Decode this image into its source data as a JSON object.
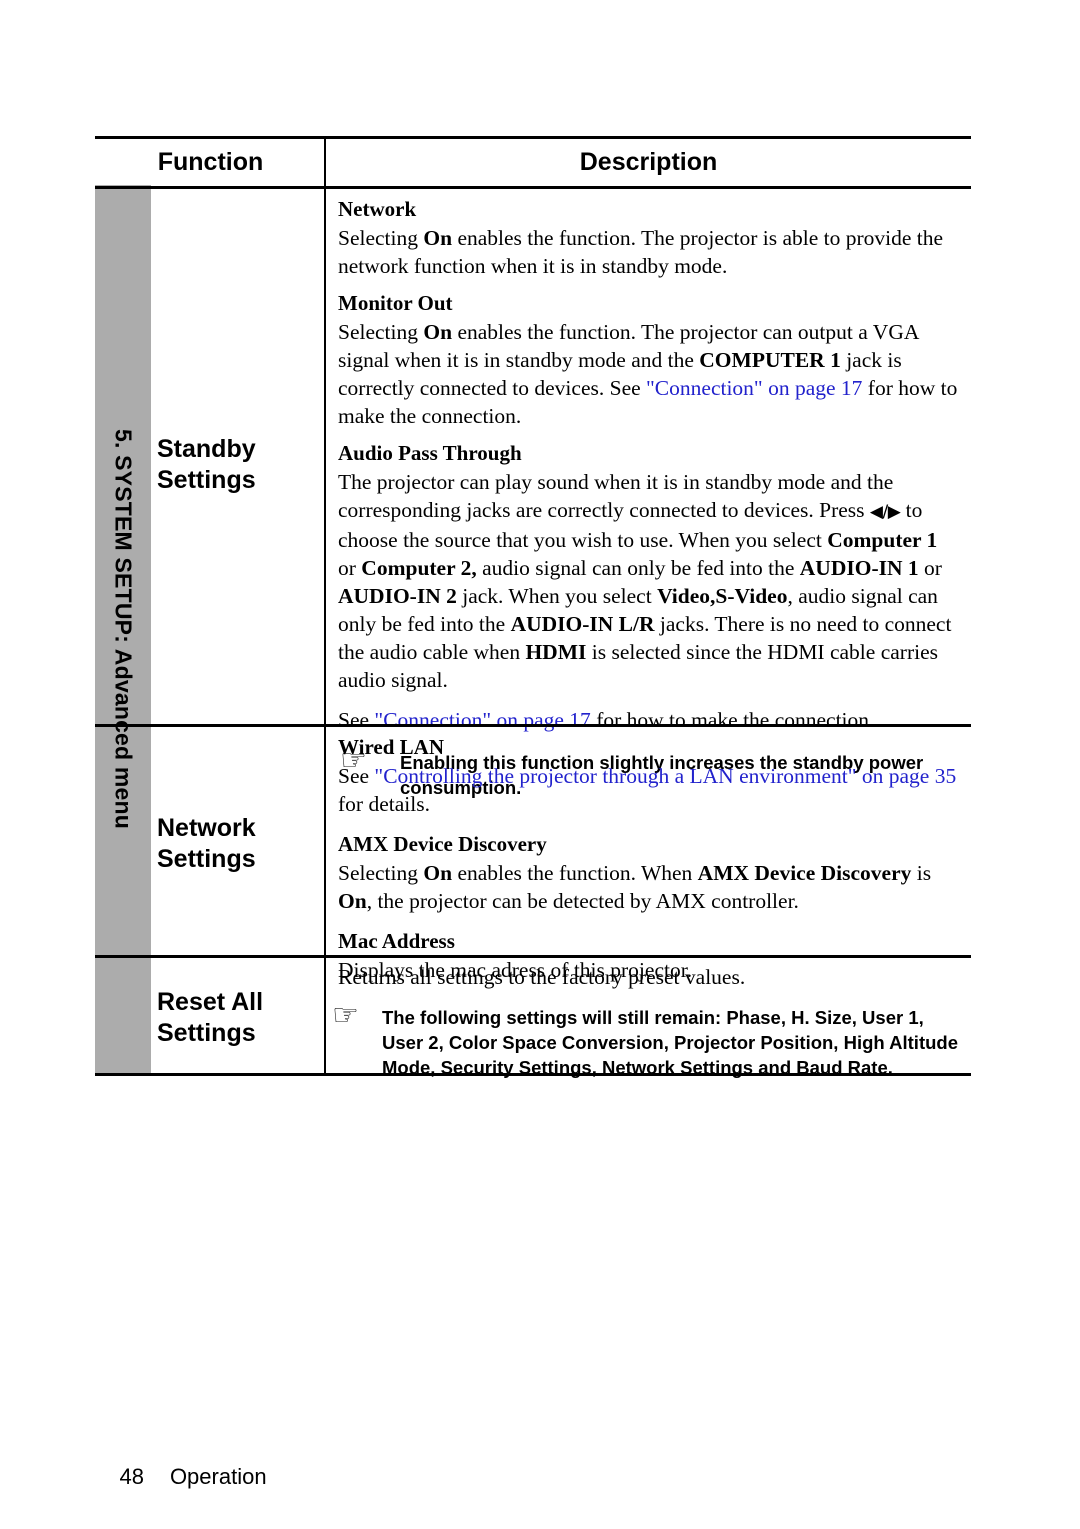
{
  "side_tab": {
    "label": "5. SYSTEM SETUP: Advanced menu"
  },
  "table": {
    "headers": {
      "function": "Function",
      "description": "Description"
    },
    "rows": [
      {
        "function": "Standby\nSettings",
        "function_line1": "Standby",
        "function_line2": "Settings",
        "blocks": [
          {
            "kind": "subhead",
            "text": "Network"
          },
          {
            "kind": "para",
            "text": "Selecting On enables the function. The projector is able to provide the network function when it is in standby mode."
          },
          {
            "kind": "subhead",
            "text": "Monitor Out"
          },
          {
            "kind": "para",
            "text": "Selecting On enables the function. The projector can output a VGA signal when it is in standby mode and the COMPUTER 1 jack is correctly connected to devices. See \"Connection\" on page 17 for how to make the connection."
          },
          {
            "kind": "subhead",
            "text": "Audio Pass Through"
          },
          {
            "kind": "para",
            "text": "The projector can play sound when it is in standby mode and the corresponding jacks are correctly connected to devices. Press ◀/▶ to choose the source that you wish to use. When you select Computer 1 or Computer 2, audio signal can only be fed into the AUDIO-IN 1 or AUDIO-IN 2 jack. When you select Video,S-Video, audio signal can only be fed into the AUDIO-IN L/R jacks. There is no need to connect the audio cable when HDMI is selected since the HDMI cable carries audio signal."
          },
          {
            "kind": "para",
            "text": "See \"Connection\" on page 17 for how to make the connection."
          },
          {
            "kind": "note",
            "icon": "pointing-hand-icon",
            "text": "Enabling this function slightly increases the standby power consumption."
          }
        ]
      },
      {
        "function": "Network\nSettings",
        "function_line1": "Network",
        "function_line2": "Settings",
        "blocks": [
          {
            "kind": "subhead",
            "text": "Wired LAN"
          },
          {
            "kind": "para",
            "text": "See \"Controlling the projector through a LAN environment\" on page 35 for details."
          },
          {
            "kind": "subhead",
            "text": "AMX Device Discovery"
          },
          {
            "kind": "para",
            "text": "Selecting On enables the function. When AMX Device Discovery is On, the projector can be detected by AMX controller."
          },
          {
            "kind": "subhead",
            "text": "Mac Address"
          },
          {
            "kind": "para",
            "text": "Displays the mac adress of this projector."
          }
        ]
      },
      {
        "function": "Reset All\nSettings",
        "function_line1": "Reset All",
        "function_line2": "Settings",
        "blocks": [
          {
            "kind": "para",
            "text": "Returns all settings to the factory preset values."
          },
          {
            "kind": "note",
            "icon": "pointing-hand-icon",
            "text": "The following settings will still remain: Phase, H. Size, User 1, User 2, Color Space Conversion, Projector Position, High Altitude Mode, Security Settings, Network Settings and Baud Rate."
          }
        ]
      }
    ]
  },
  "inline_text": {
    "network_sub": "Network",
    "network_para_a": "Selecting ",
    "network_para_on": "On",
    "network_para_b": " enables the function. The projector is able to provide the network function when it is in standby mode.",
    "monitor_sub": "Monitor Out",
    "monitor_a": "Selecting ",
    "monitor_on": "On",
    "monitor_b": " enables the function. The projector can output a VGA signal when it is in standby mode and the ",
    "monitor_computer1": "COMPUTER 1",
    "monitor_c": " jack is correctly connected to devices. See ",
    "monitor_link": "\"Connection\" on page 17",
    "monitor_d": " for how to make the connection.",
    "audio_sub": "Audio Pass Through",
    "audio_a": "The projector can play sound when it is in standby mode and the corresponding jacks are correctly connected to devices. Press ",
    "audio_arrows": "◀/▶",
    "audio_b": " to choose the source that you wish to use. When you select ",
    "audio_computer1": "Computer 1",
    "audio_c": " or ",
    "audio_computer2": "Computer 2,",
    "audio_d": " audio signal can only be fed into the ",
    "audio_in1": "AUDIO-IN 1",
    "audio_e": " or ",
    "audio_in2": "AUDIO-IN 2",
    "audio_f": " jack. When you select ",
    "audio_video": "Video,S-Video",
    "audio_g": ", audio signal can only be fed into the ",
    "audio_inlr": "AUDIO-IN L/R",
    "audio_h": " jacks. There is no need to connect the audio cable when ",
    "audio_hdmi": "HDMI",
    "audio_i": " is selected since the HDMI cable carries audio signal.",
    "see_conn_a": "See ",
    "see_conn_link": "\"Connection\" on page 17",
    "see_conn_b": " for how to make the connection.",
    "standby_note": "Enabling this function slightly increases the standby power consumption.",
    "wired_sub": "Wired LAN",
    "wired_a": "See ",
    "wired_link": "\"Controlling the projector through a LAN environment\" on page 35",
    "wired_b": " for details.",
    "amx_sub": "AMX Device Discovery",
    "amx_a": "Selecting ",
    "amx_on1": "On",
    "amx_b": " enables the function. When ",
    "amx_name": "AMX Device Discovery",
    "amx_c": " is ",
    "amx_on2": "On",
    "amx_d": ", the projector can be detected by AMX controller.",
    "mac_sub": "Mac Address",
    "mac_para": "Displays the mac adress of this projector.",
    "reset_para": "Returns all settings to the factory preset values.",
    "reset_note": "The following settings will still remain: Phase, H. Size, User 1, User 2, Color Space Conversion, Projector Position, High Altitude Mode, Security Settings, Network Settings and Baud Rate."
  },
  "icons": {
    "pointing_hand": "☞"
  },
  "footer": {
    "page_number": "48",
    "section": "Operation"
  },
  "colors": {
    "link": "#2222CC",
    "tab_gray": "#ACACAC",
    "rule": "#000000"
  }
}
